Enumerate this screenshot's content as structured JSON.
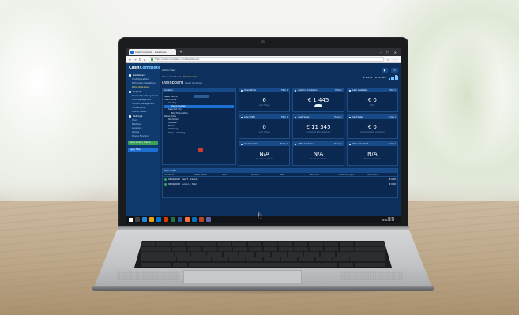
{
  "browser": {
    "tab_title": "CashComplete - Dashboard",
    "url": "https://cashcomplete.com/Dashboard"
  },
  "app": {
    "logo_main": "Cash",
    "logo_accent": "Complete",
    "user": "Admin User",
    "breadcrumb_prefix": "Home / Dashboard / ",
    "breadcrumb_highlight": "Head Quarters",
    "title": "Dashboard",
    "title_sub": "Head Quarters",
    "sidebar": {
      "dashboard_label": "Dashboard",
      "dashboard_items": [
        "Cash Operations",
        "Technology Operations",
        "Retail Operations"
      ],
      "reports_label": "Reports",
      "reports_items": [
        "Transaction Management",
        "Cash Management",
        "Content Management",
        "Transactions",
        "Device Health"
      ],
      "settings_label": "Settings",
      "settings_items": [
        "Users",
        "Machines",
        "Locations",
        "Groups",
        "Device Functions"
      ],
      "green_button": "Show as list / Unlock",
      "blue_button": "Apply filter"
    },
    "top_stats": {
      "left": "€ 1,234",
      "right": "€ 11,345"
    }
  },
  "location_panel": {
    "title": "Location",
    "rows": [
      "Sales Device",
      "Head Office",
      "Country",
      "Head Quarters",
      "Selected city",
      "Box Fin Location",
      "Retail Store",
      "Stockholm",
      "Uppsala",
      "Malmo",
      "Göteborg",
      "Kiosk & Vending"
    ]
  },
  "widgets": [
    {
      "title": "Open Shifts",
      "filter": "Filter ▾",
      "value": "6",
      "sub": "Last 7 days"
    },
    {
      "title": "Cash in Circulation",
      "filter": "Filter ▾",
      "value": "€ 1 445",
      "sub": "Total"
    },
    {
      "title": "Cash available",
      "filter": "Filter ▾",
      "value": "€ 0",
      "sub": "Total"
    },
    {
      "title": "Late Shifts",
      "filter": "Filter ▾",
      "value": "0",
      "sub": "Last 7 days"
    },
    {
      "title": "Cash Sales",
      "filter": "Today ▾",
      "value": "€ 11 345",
      "sub": "Compared with yesterday"
    },
    {
      "title": "Card Sales",
      "filter": "Today ▾",
      "value": "€ 0",
      "sub": "Compared with yesterday"
    },
    {
      "title": "Voucher Sales",
      "filter": "Today ▾",
      "value": "N/A",
      "sub": "No data available"
    },
    {
      "title": "Gift Card Sales",
      "filter": "Today ▾",
      "value": "N/A",
      "sub": "No data available"
    },
    {
      "title": "Other Non-Cash",
      "filter": "Today ▾",
      "value": "N/A",
      "sub": "No data available"
    }
  ],
  "shifts_panel": {
    "title": "Open Shifts",
    "columns": [
      "Started At",
      "Cashier Name",
      "Role",
      "Machine",
      "Site",
      "Start Time",
      "Transaction Type",
      "Till Amount"
    ],
    "rows": [
      {
        "date": "09/09/2022",
        "name": "Alex T. · Cashier",
        "amount": "€ 0.00"
      },
      {
        "date": "09/09/2022",
        "name": "Lucas L. · Team",
        "amount": "€ 0.00"
      }
    ]
  },
  "taskbar": {
    "time": "14:52",
    "date": "2018-09-13"
  },
  "colors": {
    "app_background": "#0c2f5c",
    "sidebar": "#0f3a6e",
    "panel_header": "#164a88",
    "accent_yellow": "#ffd24a",
    "green": "#3aa15a",
    "red": "#d23a2a"
  }
}
